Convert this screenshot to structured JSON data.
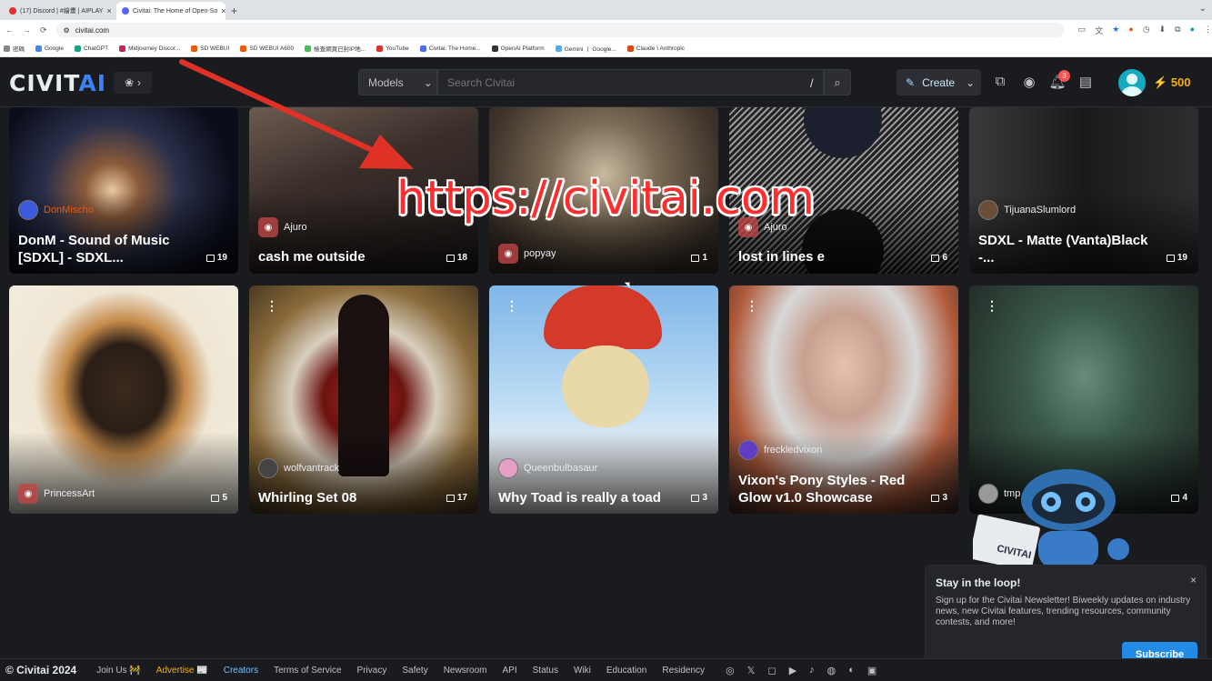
{
  "browser": {
    "tabs": [
      {
        "label": "(17) Discord | #繪畫 | AIPLAY"
      },
      {
        "label": "Civitai: The Home of Open-So"
      }
    ],
    "url": "civitai.com",
    "bookmarks": [
      "密碼",
      "Google",
      "ChatGPT",
      "Midjourney Discor...",
      "SD WEBUI",
      "SD WEBUI A600",
      "檢查網頁已封IP地...",
      "YouTube",
      "Civitai: The Home...",
      "OpenAI Platform",
      "Gemini 丨 Google...",
      "Claude \\ Anthropic"
    ]
  },
  "header": {
    "logo_civ": "CIVIT",
    "logo_ai": "AI",
    "search_scope": "Models",
    "search_placeholder": "Search Civitai",
    "search_shortcut": "/",
    "create_label": "Create",
    "notification_count": "3",
    "buzz_amount": "500"
  },
  "overlay": {
    "url_text": "https://civitai.com"
  },
  "cards_row1": [
    {
      "user": "DonMischo",
      "title": "DonM - Sound of Music [SDXL] - SDXL...",
      "count": "19"
    },
    {
      "user": "Ajuro",
      "title": "cash me outside",
      "count": "18"
    },
    {
      "user": "popyay",
      "title": "",
      "count": "1"
    },
    {
      "user": "Ajuro",
      "title": "lost in lines e",
      "count": "6"
    },
    {
      "user": "TijuanaSlumlord",
      "title": "SDXL - Matte (Vanta)Black -...",
      "count": "19"
    }
  ],
  "cards_row2": [
    {
      "user": "PrincessArt",
      "title": "",
      "count": "5"
    },
    {
      "user": "wolfvantrack",
      "title": "Whirling Set 08",
      "count": "17"
    },
    {
      "user": "Queenbulbasaur",
      "title": "Why Toad is really a toad",
      "count": "3"
    },
    {
      "user": "freckledvixon",
      "title": "Vixon's Pony Styles - Red Glow v1.0 Showcase",
      "count": "3"
    },
    {
      "user": "tmp",
      "title": "",
      "count": "4"
    }
  ],
  "newsletter": {
    "title": "Stay in the loop!",
    "text": "Sign up for the Civitai Newsletter! Biweekly updates on industry news, new Civitai features, trending resources, community contests, and more!",
    "subscribe_label": "Subscribe",
    "close_label": "×"
  },
  "footer": {
    "copyright": "© Civitai 2024",
    "links": [
      "Join Us 🚧",
      "Advertise 📰",
      "Creators",
      "Terms of Service",
      "Privacy",
      "Safety",
      "Newsroom",
      "API",
      "Status",
      "Wiki",
      "Education",
      "Residency"
    ]
  },
  "colors": {
    "accent": "#228be6",
    "logo_ai": "#3b82f6",
    "buzz": "#fab005",
    "overlay_red": "#ff2d2d"
  }
}
